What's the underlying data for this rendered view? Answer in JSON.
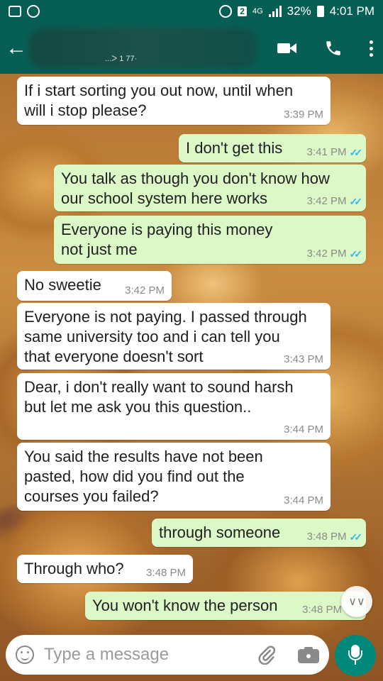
{
  "status_bar": {
    "network": "4G",
    "badge": "2",
    "battery": "32%",
    "time": "4:01 PM"
  },
  "header": {
    "contact_name": "...ᐳ 1 77·"
  },
  "messages": [
    {
      "direction": "incoming",
      "lines": [
        "If i start sorting you out now, until when",
        "will i stop please?"
      ],
      "time": "3:39 PM"
    },
    {
      "direction": "outgoing",
      "lines": [
        "I don't get this"
      ],
      "time": "3:41 PM",
      "read": true
    },
    {
      "direction": "outgoing",
      "lines": [
        "You talk as though you don't know how",
        "our school system here works"
      ],
      "time": "3:42 PM",
      "read": true
    },
    {
      "direction": "outgoing",
      "lines": [
        "Everyone is paying this money",
        "not just me"
      ],
      "time": "3:42 PM",
      "read": true
    },
    {
      "direction": "incoming",
      "lines": [
        "No sweetie"
      ],
      "time": "3:42 PM"
    },
    {
      "direction": "incoming",
      "lines": [
        "Everyone is not paying. I passed through",
        "same university too and i can tell you",
        "that everyone doesn't sort"
      ],
      "time": "3:43 PM"
    },
    {
      "direction": "incoming",
      "lines": [
        "Dear, i don't really want to sound harsh",
        "but let me ask you this question.."
      ],
      "time": "3:44 PM"
    },
    {
      "direction": "incoming",
      "lines": [
        "You said the results have not been",
        "pasted, how did you find out the",
        "courses you failed?"
      ],
      "time": "3:44 PM"
    },
    {
      "direction": "outgoing",
      "lines": [
        "through someone"
      ],
      "time": "3:48 PM",
      "read": true
    },
    {
      "direction": "incoming",
      "lines": [
        "Through who?"
      ],
      "time": "3:48 PM"
    },
    {
      "direction": "outgoing",
      "lines": [
        "You won't know the person"
      ],
      "time": "3:48 PM"
    }
  ],
  "input": {
    "placeholder": "Type a message"
  },
  "colors": {
    "header": "#075e54",
    "outgoing_bubble": "#dcf8c6",
    "incoming_bubble": "#ffffff",
    "read_tick": "#34b7f1",
    "mic_button": "#00897b"
  }
}
